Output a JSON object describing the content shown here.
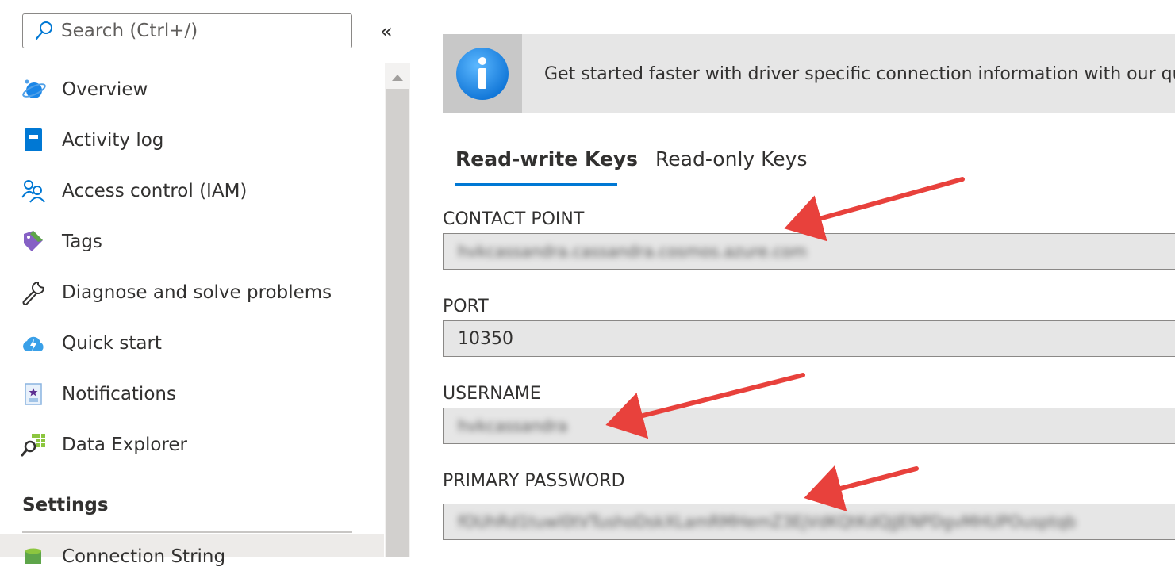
{
  "search": {
    "placeholder": "Search (Ctrl+/)"
  },
  "sidebar": {
    "collapse_glyph": "«",
    "items": [
      {
        "label": "Overview",
        "icon": "cosmos-db-icon"
      },
      {
        "label": "Activity log",
        "icon": "activity-log-icon"
      },
      {
        "label": "Access control (IAM)",
        "icon": "people-icon"
      },
      {
        "label": "Tags",
        "icon": "tag-icon"
      },
      {
        "label": "Diagnose and solve problems",
        "icon": "wrench-icon"
      },
      {
        "label": "Quick start",
        "icon": "cloud-lightning-icon"
      },
      {
        "label": "Notifications",
        "icon": "notification-icon"
      },
      {
        "label": "Data Explorer",
        "icon": "data-explorer-icon"
      }
    ],
    "section_header": "Settings",
    "selected_item": {
      "label": "Connection String",
      "icon": "database-icon"
    }
  },
  "banner": {
    "text": "Get started faster with driver specific connection information with our quick"
  },
  "tabs": [
    {
      "label": "Read-write Keys",
      "active": true
    },
    {
      "label": "Read-only Keys",
      "active": false
    }
  ],
  "fields": {
    "contact_point": {
      "label": "CONTACT POINT",
      "value": "hvkcassandra.cassandra.cosmos.azure.com"
    },
    "port": {
      "label": "PORT",
      "value": "10350"
    },
    "username": {
      "label": "USERNAME",
      "value": "hvkcassandra"
    },
    "primary_password": {
      "label": "PRIMARY PASSWORD",
      "value": "fOUhRd1tuwl0tVTushoDskXLamRMHemZ3EjVdKQtKdQjJENPDgvMHUPOusptqb"
    }
  },
  "colors": {
    "accent": "#0078d4",
    "arrow": "#e8413c",
    "info_icon": "#1a86e8"
  }
}
